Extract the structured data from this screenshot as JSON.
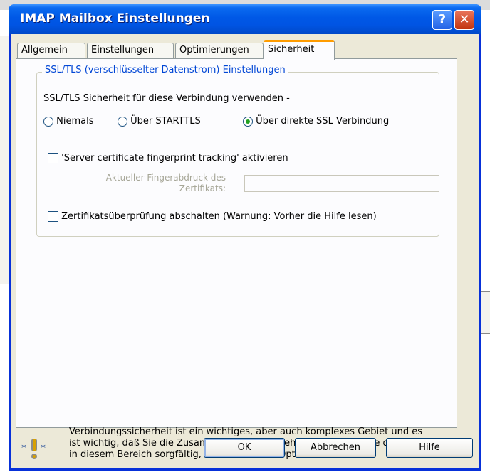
{
  "window": {
    "title": "IMAP Mailbox Einstellungen",
    "help_glyph": "?",
    "close_glyph": "✕"
  },
  "tabs": [
    {
      "label": "Allgemein"
    },
    {
      "label": "Einstellungen"
    },
    {
      "label": "Optimierungen"
    },
    {
      "label": "Sicherheit",
      "active": true
    }
  ],
  "ssl_group": {
    "legend": "SSL/TLS (verschlüsselter Datenstrom) Einstellungen",
    "prompt": "SSL/TLS Sicherheit für diese Verbindung verwenden -",
    "options": [
      {
        "label": "Niemals",
        "selected": false
      },
      {
        "label": "Über STARTTLS",
        "selected": false
      },
      {
        "label": "Über direkte SSL Verbindung",
        "selected": true
      }
    ],
    "fingerprint_checkbox": {
      "label": "'Server certificate fingerprint tracking' aktivieren",
      "checked": false
    },
    "fingerprint_label_line1": "Aktueller Fingerabdruck des",
    "fingerprint_label_line2": "Zertifikats:",
    "fingerprint_value": "",
    "disable_check_checkbox": {
      "label": "Zertifikatsüberprüfung abschalten (Warnung: Vorher die Hilfe lesen)",
      "checked": false
    }
  },
  "info": {
    "icon": "warning-info-icon",
    "text": "Verbindungssicherheit ist ein wichtiges, aber auch komplexes Gebiet und es ist wichtig, daß Sie die Zusammenhänge verstehen. Bitte lesen Sie die Hilfe in diesem Bereich sorgfältig, bevor Sie diese Optionen benutzen."
  },
  "buttons": {
    "ok": "OK",
    "cancel": "Abbrechen",
    "help": "Hilfe"
  },
  "colors": {
    "titlebar": "#0054e3",
    "legend": "#0046d5",
    "active_tab_accent": "#ff9c00",
    "selected_radio": "#21a121"
  }
}
